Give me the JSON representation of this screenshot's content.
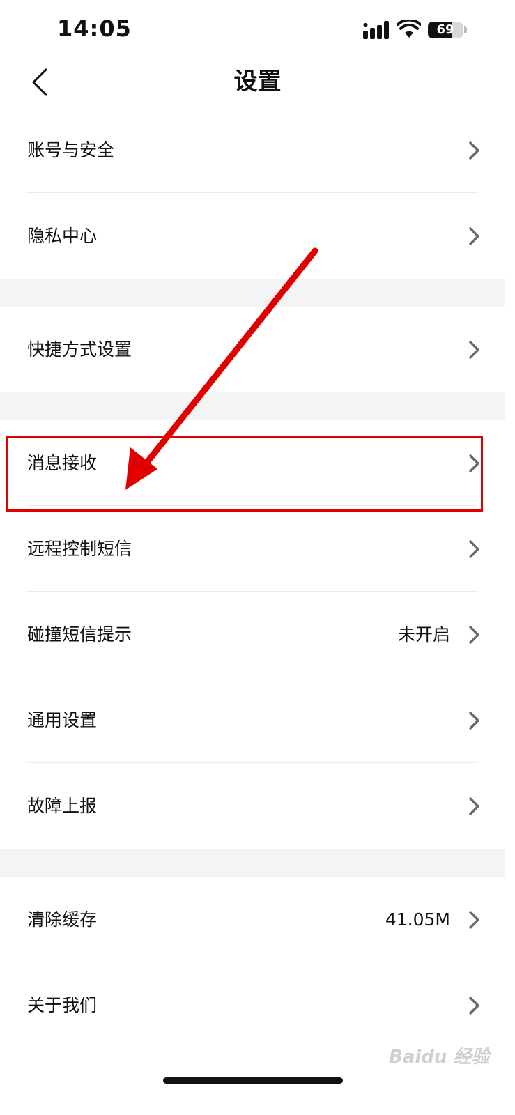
{
  "status_bar": {
    "time": "14:05",
    "battery": "69",
    "battery_percent": 69
  },
  "nav": {
    "title": "设置"
  },
  "sections": [
    {
      "items": [
        {
          "label": "账号与安全"
        },
        {
          "label": "隐私中心"
        }
      ]
    },
    {
      "items": [
        {
          "label": "快捷方式设置"
        }
      ]
    },
    {
      "items": [
        {
          "label": "消息接收"
        },
        {
          "label": "远程控制短信"
        },
        {
          "label": "碰撞短信提示",
          "value": "未开启"
        },
        {
          "label": "通用设置"
        },
        {
          "label": "故障上报"
        }
      ]
    },
    {
      "items": [
        {
          "label": "清除缓存",
          "value": "41.05M"
        },
        {
          "label": "关于我们"
        }
      ]
    }
  ],
  "watermark": {
    "text": "Baidu 经验"
  },
  "colors": {
    "annotation": "#e10000",
    "section_gap": "#f4f4f4",
    "chevron": "#6b6b6b"
  }
}
